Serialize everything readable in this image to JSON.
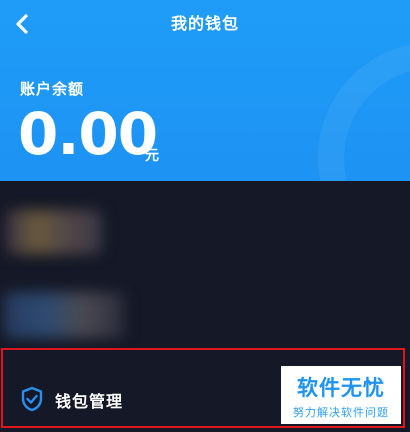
{
  "header": {
    "title": "我的钱包",
    "back_icon": "chevron-left-icon",
    "background": "#1f9cf8"
  },
  "balance": {
    "label": "账户余额",
    "amount": "0.00",
    "unit": "元"
  },
  "wallet_management": {
    "icon": "shield-check-icon",
    "label": "钱包管理",
    "highlight_color": "#e0141c"
  },
  "watermark": {
    "main": "软件无忧",
    "sub": "努力解决软件问题"
  }
}
